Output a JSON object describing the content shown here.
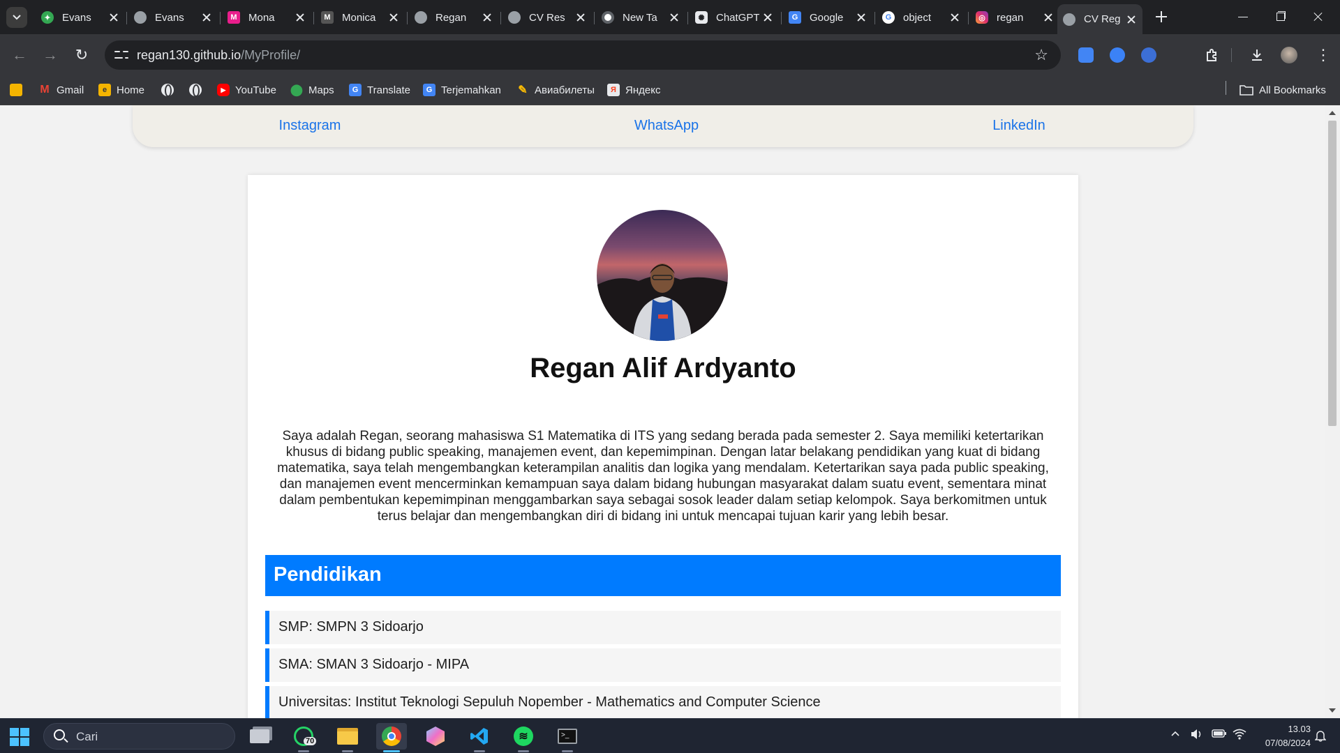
{
  "browser": {
    "tabs": [
      {
        "title": "Evans",
        "favicon": "evans-favicon",
        "color": "#34a853"
      },
      {
        "title": "Evans",
        "favicon": "globe-favicon",
        "color": "#9aa0a6"
      },
      {
        "title": "Mona",
        "favicon": "mona-favicon",
        "color": "#e91e8c"
      },
      {
        "title": "Monica",
        "favicon": "monica-favicon",
        "color": "#555555"
      },
      {
        "title": "Regan",
        "favicon": "globe-favicon",
        "color": "#9aa0a6"
      },
      {
        "title": "CV Res",
        "favicon": "globe-favicon",
        "color": "#9aa0a6"
      },
      {
        "title": "New Ta",
        "favicon": "chrome-favicon",
        "color": "#ffffff"
      },
      {
        "title": "ChatGPT",
        "favicon": "chatgpt-favicon",
        "color": "#e8eaed"
      },
      {
        "title": "Google",
        "favicon": "google-translate-favicon",
        "color": "#4285f4"
      },
      {
        "title": "object",
        "favicon": "google-favicon",
        "color": "#ffffff"
      },
      {
        "title": "regan",
        "favicon": "instagram-favicon",
        "color": "#e1306c"
      },
      {
        "title": "CV Reg",
        "favicon": "globe-favicon",
        "color": "#9aa0a6",
        "active": true
      }
    ],
    "url_host": "regan130.github.io",
    "url_path": "/MyProfile/",
    "bookmarks": [
      {
        "label": "",
        "icon": "google-classroom-icon"
      },
      {
        "label": "Gmail",
        "icon": "gmail-icon"
      },
      {
        "label": "Home",
        "icon": "home-icon"
      },
      {
        "label": "",
        "icon": "globe-icon"
      },
      {
        "label": "",
        "icon": "globe-icon"
      },
      {
        "label": "YouTube",
        "icon": "youtube-icon"
      },
      {
        "label": "Maps",
        "icon": "maps-icon"
      },
      {
        "label": "Translate",
        "icon": "translate-icon"
      },
      {
        "label": "Terjemahkan",
        "icon": "translate-icon"
      },
      {
        "label": "Авиабилеты",
        "icon": "pencil-icon"
      },
      {
        "label": "Яндекс",
        "icon": "yandex-icon"
      }
    ],
    "all_bookmarks_label": "All Bookmarks"
  },
  "page": {
    "social_links": [
      {
        "label": "Instagram"
      },
      {
        "label": "WhatsApp"
      },
      {
        "label": "LinkedIn"
      }
    ],
    "name": "Regan Alif Ardyanto",
    "bio": "Saya adalah Regan, seorang mahasiswa S1 Matematika di ITS yang sedang berada pada semester 2. Saya memiliki ketertarikan khusus di bidang public speaking, manajemen event, dan kepemimpinan. Dengan latar belakang pendidikan yang kuat di bidang matematika, saya telah mengembangkan keterampilan analitis dan logika yang mendalam. Ketertarikan saya pada public speaking, dan manajemen event mencerminkan kemampuan saya dalam bidang hubungan masyarakat dalam suatu event, sementara minat dalam pembentukan kepemimpinan menggambarkan saya sebagai sosok leader dalam setiap kelompok. Saya berkomitmen untuk terus belajar dan mengembangkan diri di bidang ini untuk mencapai tujuan karir yang lebih besar.",
    "education_title": "Pendidikan",
    "education": [
      "SMP: SMPN 3 Sidoarjo",
      "SMA: SMAN 3 Sidoarjo - MIPA",
      "Universitas: Institut Teknologi Sepuluh Nopember - Mathematics and Computer Science"
    ],
    "accent_color": "#007bff",
    "link_color": "#1a73e8"
  },
  "taskbar": {
    "search_placeholder": "Cari",
    "whatsapp_badge": "70",
    "time": "13.03",
    "date": "07/08/2024"
  }
}
